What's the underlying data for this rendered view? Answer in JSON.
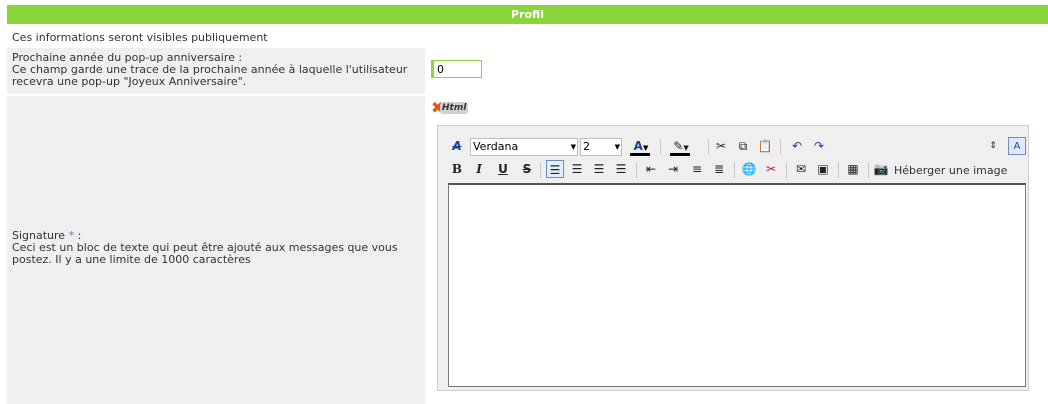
{
  "section": {
    "title": "Profil"
  },
  "intro": "Ces informations seront visibles publiquement",
  "birthday": {
    "label": "Prochaine année du pop-up anniversaire :",
    "help": "Ce champ garde une trace de la prochaine année à laquelle l'utilisateur recevra une pop-up \"Joyeux Anniversaire\".",
    "value": "0"
  },
  "signature": {
    "label": "Signature",
    "required": "*",
    "colon": " :",
    "help": "Ceci est un bloc de texte qui peut être ajouté aux messages que vous postez. Il y a une limite de 1000 caractères",
    "html_badge": "Html"
  },
  "editor": {
    "font_name": "Verdana",
    "font_size": "2",
    "toolbar": {
      "bold": "B",
      "italic": "I",
      "underline": "U",
      "strike": "S",
      "host_image": "Héberger une image"
    },
    "content": ""
  },
  "colors": {
    "header": "#8ad53a",
    "accent": "#3a8fd1"
  }
}
